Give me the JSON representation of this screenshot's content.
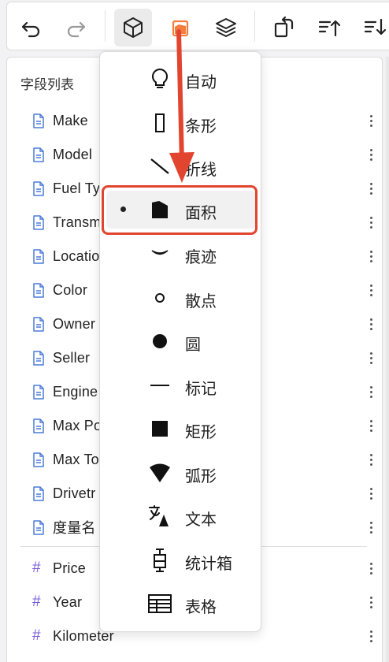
{
  "toolbar": {
    "buttons": [
      {
        "name": "undo-icon"
      },
      {
        "name": "redo-icon"
      },
      {
        "name": "mark-type-icon"
      },
      {
        "name": "area-mark-icon"
      },
      {
        "name": "layers-icon"
      },
      {
        "name": "rotate-icon"
      },
      {
        "name": "sort-ascending-icon"
      },
      {
        "name": "sort-descending-icon"
      }
    ],
    "accent_color": "#f47c3c"
  },
  "field_panel": {
    "title": "字段列表",
    "dimension_fields": [
      "Make",
      "Model",
      "Fuel Ty",
      "Transm",
      "Locatio",
      "Color",
      "Owner",
      "Seller",
      "Engine",
      "Max Po",
      "Max To",
      "Drivetr",
      "度量名"
    ],
    "measure_fields": [
      "Price",
      "Year",
      "Kilometer"
    ],
    "dimension_icon": "document-icon",
    "measure_icon": "#"
  },
  "mark_menu": {
    "items": [
      {
        "label": "自动",
        "icon": "lightbulb-icon"
      },
      {
        "label": "条形",
        "icon": "bar-icon"
      },
      {
        "label": "折线",
        "icon": "line-icon"
      },
      {
        "label": "面积",
        "icon": "area-icon",
        "selected": true
      },
      {
        "label": "痕迹",
        "icon": "trail-icon"
      },
      {
        "label": "散点",
        "icon": "point-icon"
      },
      {
        "label": "圆",
        "icon": "circle-icon"
      },
      {
        "label": "标记",
        "icon": "tick-icon"
      },
      {
        "label": "矩形",
        "icon": "rect-icon"
      },
      {
        "label": "弧形",
        "icon": "arc-icon"
      },
      {
        "label": "文本",
        "icon": "text-icon"
      },
      {
        "label": "统计箱",
        "icon": "boxplot-icon"
      },
      {
        "label": "表格",
        "icon": "table-icon"
      }
    ]
  },
  "annotation": {
    "highlight_color": "#e2452f"
  }
}
